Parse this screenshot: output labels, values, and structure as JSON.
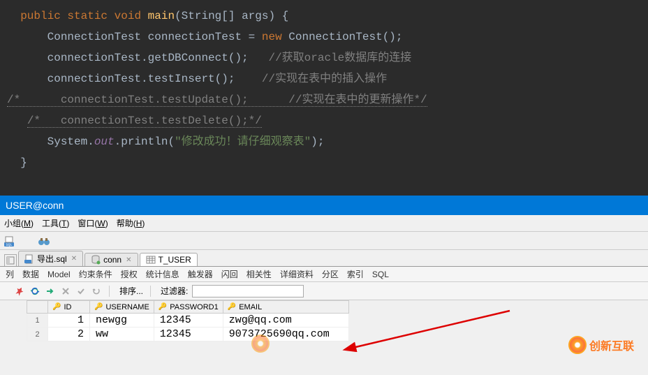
{
  "code": {
    "lines": [
      {
        "indent": "  ",
        "tokens": [
          {
            "t": "public ",
            "c": "keyword"
          },
          {
            "t": "static ",
            "c": "keyword"
          },
          {
            "t": "void ",
            "c": "keyword"
          },
          {
            "t": "main",
            "c": "method-name"
          },
          {
            "t": "(String[] args) {"
          }
        ]
      },
      {
        "indent": "      ",
        "tokens": [
          {
            "t": "ConnectionTest connectionTest = "
          },
          {
            "t": "new ",
            "c": "keyword"
          },
          {
            "t": "ConnectionTest();"
          }
        ]
      },
      {
        "indent": "      ",
        "tokens": [
          {
            "t": "connectionTest.getDBConnect();   "
          },
          {
            "t": "//获取oracle数据库的连接",
            "c": "comment"
          }
        ]
      },
      {
        "indent": "      ",
        "tokens": [
          {
            "t": "connectionTest.testInsert();    "
          },
          {
            "t": "//实现在表中的插入操作",
            "c": "comment"
          }
        ]
      },
      {
        "indent": "",
        "tokens": [
          {
            "t": "/*      connectionTest.testUpdate();      //实现在表中的更新操作*/",
            "c": "comment marked"
          }
        ]
      },
      {
        "indent": "   ",
        "tokens": [
          {
            "t": "/*   connectionTest.testDelete();*/",
            "c": "comment marked"
          }
        ]
      },
      {
        "indent": "      ",
        "tokens": [
          {
            "t": "System."
          },
          {
            "t": "out",
            "c": "static-field"
          },
          {
            "t": ".println("
          },
          {
            "t": "\"修改成功！请仔细观察表\"",
            "c": "string"
          },
          {
            "t": ");"
          }
        ]
      },
      {
        "indent": "  ",
        "tokens": [
          {
            "t": "}"
          }
        ]
      }
    ]
  },
  "blueBar": {
    "title": "USER@conn"
  },
  "menu": {
    "items": [
      {
        "label": "小组",
        "key": "M"
      },
      {
        "label": "工具",
        "key": "T"
      },
      {
        "label": "窗口",
        "key": "W"
      },
      {
        "label": "帮助",
        "key": "H"
      }
    ]
  },
  "tabs": [
    {
      "label": "导出.sql",
      "icon": "sql-file",
      "closable": true
    },
    {
      "label": "conn",
      "icon": "db",
      "closable": true
    },
    {
      "label": "T_USER",
      "icon": "table",
      "closable": false
    }
  ],
  "subNav": {
    "items": [
      "列",
      "数据",
      "Model",
      "约束条件",
      "授权",
      "统计信息",
      "触发器",
      "闪回",
      "相关性",
      "详细资料",
      "分区",
      "索引",
      "SQL"
    ]
  },
  "actionBar": {
    "sortLabel": "排序...",
    "filterLabel": "过滤器:",
    "filterValue": ""
  },
  "table": {
    "columns": [
      "ID",
      "USERNAME",
      "PASSWORD1",
      "EMAIL"
    ],
    "rows": [
      {
        "n": 1,
        "id": "1",
        "username": "newgg",
        "password": "12345",
        "email": "zwg@qq.com"
      },
      {
        "n": 2,
        "id": "2",
        "username": "ww",
        "password": "12345",
        "email": "9073725690qq.com"
      }
    ]
  },
  "watermark": {
    "text": "创新互联"
  }
}
